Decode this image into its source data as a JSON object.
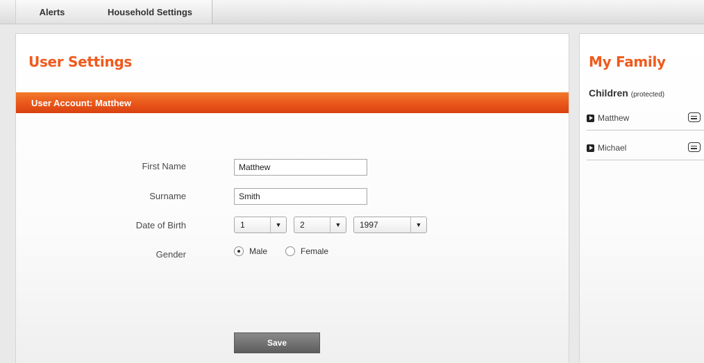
{
  "tabs": [
    {
      "label": "Alerts"
    },
    {
      "label": "Household Settings"
    }
  ],
  "main": {
    "title": "User Settings",
    "section_title": "User Account: Matthew",
    "form": {
      "first_name_label": "First Name",
      "first_name_value": "Matthew",
      "surname_label": "Surname",
      "surname_value": "Smith",
      "dob_label": "Date of Birth",
      "dob_day": "1",
      "dob_month": "2",
      "dob_year": "1997",
      "gender_label": "Gender",
      "gender_options": [
        "Male",
        "Female"
      ],
      "gender_selected": "Male"
    },
    "save_label": "Save"
  },
  "side": {
    "title": "My Family",
    "children_heading": "Children",
    "children_note": "(protected)",
    "children": [
      {
        "name": "Matthew"
      },
      {
        "name": "Michael"
      }
    ]
  },
  "colors": {
    "accent": "#ef5a1d",
    "section_bar": "#e9561a",
    "button": "#6e6e6e"
  }
}
